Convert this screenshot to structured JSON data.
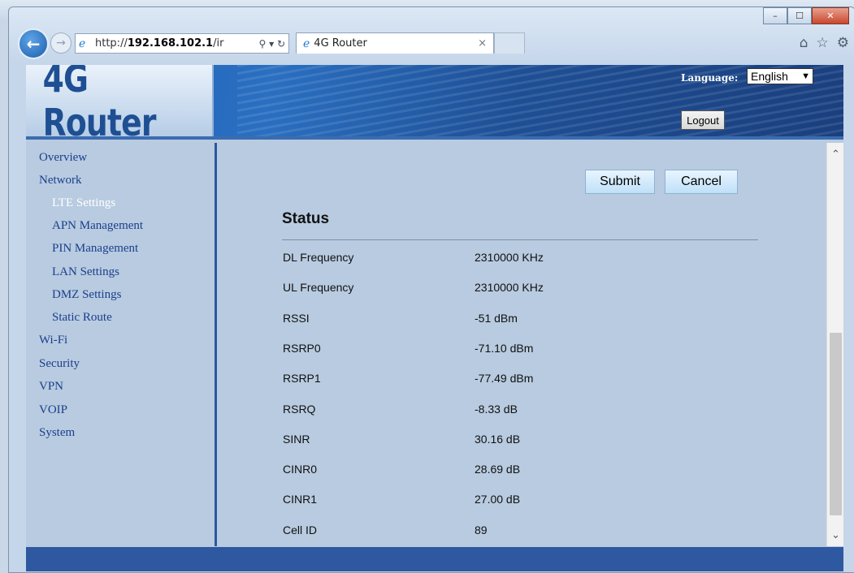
{
  "browser": {
    "address_prefix": "http://",
    "address_host": "192.168.102.1",
    "address_suffix": "/ir",
    "address_tools": "⚲ ▾ ↻",
    "tab_title": "4G Router",
    "tab_close": "×",
    "window_controls": [
      "–",
      "☐",
      "✕"
    ],
    "toolbar_icons": [
      "⌂",
      "☆",
      "⚙"
    ]
  },
  "banner": {
    "logo": "4G Router",
    "language_label": "Language:",
    "language_value": "English",
    "logout_label": "Logout"
  },
  "sidebar": {
    "items": [
      {
        "label": "Overview",
        "level": 0,
        "active": false
      },
      {
        "label": "Network",
        "level": 0,
        "active": false
      },
      {
        "label": "LTE Settings",
        "level": 1,
        "active": true
      },
      {
        "label": "APN Management",
        "level": 1,
        "active": false
      },
      {
        "label": "PIN Management",
        "level": 1,
        "active": false
      },
      {
        "label": "LAN Settings",
        "level": 1,
        "active": false
      },
      {
        "label": "DMZ Settings",
        "level": 1,
        "active": false
      },
      {
        "label": "Static Route",
        "level": 1,
        "active": false
      },
      {
        "label": "Wi-Fi",
        "level": 0,
        "active": false
      },
      {
        "label": "Security",
        "level": 0,
        "active": false
      },
      {
        "label": "VPN",
        "level": 0,
        "active": false
      },
      {
        "label": "VOIP",
        "level": 0,
        "active": false
      },
      {
        "label": "System",
        "level": 0,
        "active": false
      }
    ]
  },
  "main": {
    "submit_label": "Submit",
    "cancel_label": "Cancel",
    "status_title": "Status",
    "rows": [
      {
        "label": "DL Frequency",
        "value": "2310000 KHz"
      },
      {
        "label": "UL Frequency",
        "value": "2310000 KHz"
      },
      {
        "label": "RSSI",
        "value": "-51 dBm"
      },
      {
        "label": "RSRP0",
        "value": "-71.10 dBm"
      },
      {
        "label": "RSRP1",
        "value": "-77.49 dBm"
      },
      {
        "label": "RSRQ",
        "value": "-8.33 dB"
      },
      {
        "label": "SINR",
        "value": "30.16 dB"
      },
      {
        "label": "CINR0",
        "value": "28.69 dB"
      },
      {
        "label": "CINR1",
        "value": "27.00 dB"
      },
      {
        "label": "Cell ID",
        "value": "89"
      }
    ]
  },
  "scrollbar": {
    "up": "⌃",
    "down": "⌄"
  }
}
